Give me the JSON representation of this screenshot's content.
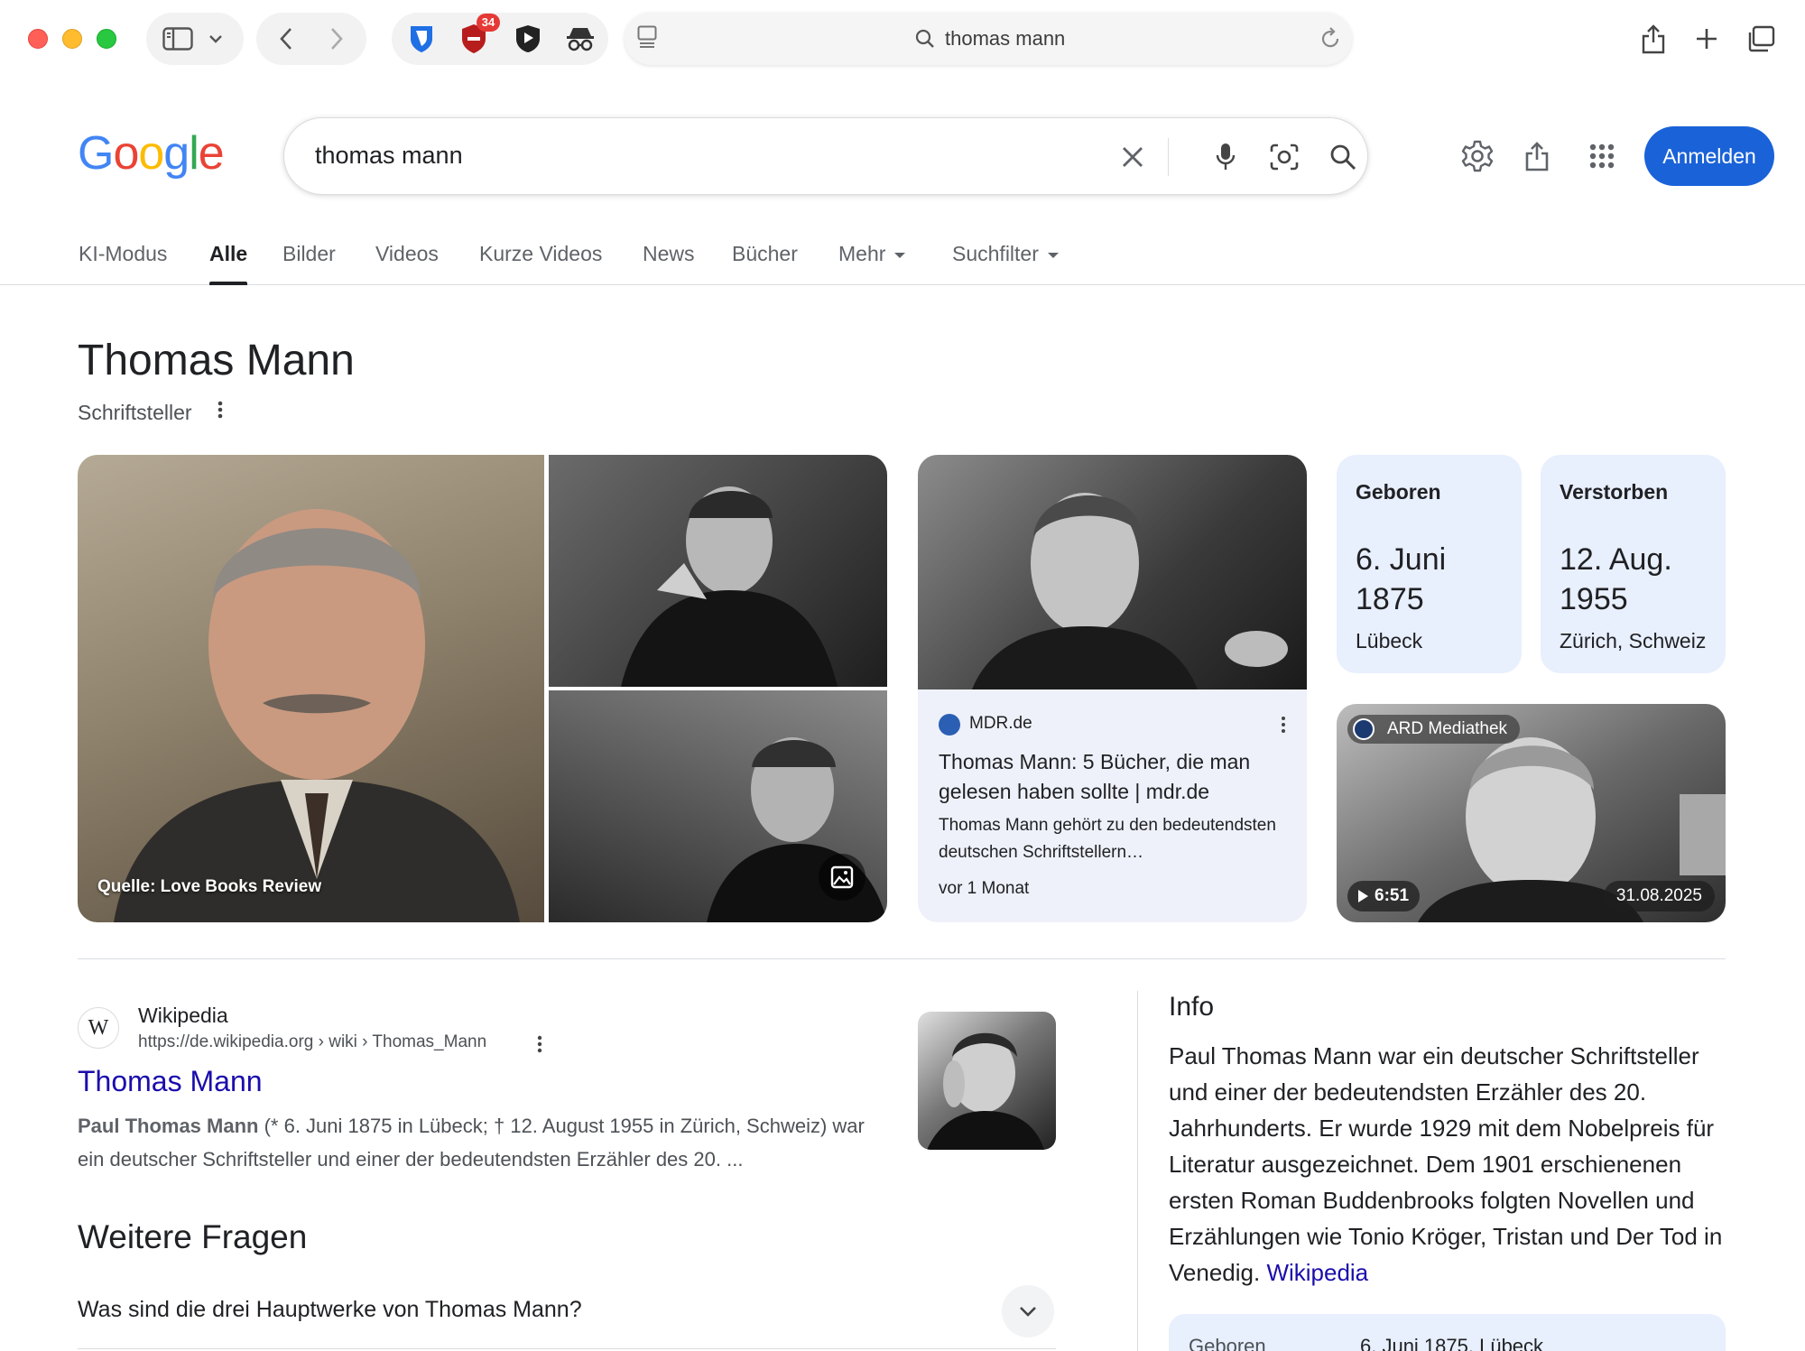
{
  "browser": {
    "address": "thomas mann",
    "extension_badge": "34"
  },
  "google": {
    "logo_letters": [
      {
        "ch": "G",
        "color": "#4285f4"
      },
      {
        "ch": "o",
        "color": "#ea4335"
      },
      {
        "ch": "o",
        "color": "#fbbc05"
      },
      {
        "ch": "g",
        "color": "#4285f4"
      },
      {
        "ch": "l",
        "color": "#34a853"
      },
      {
        "ch": "e",
        "color": "#ea4335"
      }
    ],
    "query": "thomas mann",
    "signin_label": "Anmelden"
  },
  "tabs": [
    {
      "label": "KI-Modus"
    },
    {
      "label": "Alle",
      "active": true
    },
    {
      "label": "Bilder"
    },
    {
      "label": "Videos"
    },
    {
      "label": "Kurze Videos"
    },
    {
      "label": "News"
    },
    {
      "label": "Bücher"
    },
    {
      "label": "Mehr",
      "dropdown": true
    },
    {
      "label": "Suchfilter",
      "dropdown": true
    }
  ],
  "entity": {
    "title": "Thomas Mann",
    "subtitle": "Schriftsteller",
    "photo_source": "Quelle: Love Books Review"
  },
  "article": {
    "source": "MDR.de",
    "title": "Thomas Mann: 5 Bücher, die man gelesen haben sollte | mdr.de",
    "snippet": "Thomas Mann gehört zu den bedeutendsten deutschen Schriftstellern…",
    "age": "vor 1 Monat"
  },
  "facts": {
    "born": {
      "label": "Geboren",
      "date": "6. Juni 1875",
      "place": "Lübeck"
    },
    "died": {
      "label": "Verstorben",
      "date": "12. Aug. 1955",
      "place": "Zürich, Schweiz"
    }
  },
  "video": {
    "source": "ARD Mediathek",
    "duration": "6:51",
    "date": "31.08.2025"
  },
  "wiki_result": {
    "site": "Wikipedia",
    "url": "https://de.wikipedia.org › wiki › Thomas_Mann",
    "title": "Thomas Mann",
    "snippet_bold": "Paul Thomas Mann",
    "snippet_rest": " (* 6. Juni 1875 in Lübeck; † 12. August 1955 in Zürich, Schweiz) war ein deutscher Schriftsteller und einer der bedeutendsten Erzähler des 20. ..."
  },
  "questions": {
    "heading": "Weitere Fragen",
    "items": [
      "Was sind die drei Hauptwerke von Thomas Mann?"
    ]
  },
  "info": {
    "heading": "Info",
    "text": "Paul Thomas Mann war ein deutscher Schriftsteller und einer der bedeutendsten Erzähler des 20. Jahrhunderts. Er wurde 1929 mit dem Nobelpreis für Literatur ausgezeichnet. Dem 1901 erschienenen ersten Roman Buddenbrooks folgten Novellen und Erzählungen wie Tonio Kröger, Tristan und Der Tod in Venedig. ",
    "link": "Wikipedia",
    "row_label": "Geboren",
    "row_value": "6. Juni 1875, Lübeck"
  }
}
